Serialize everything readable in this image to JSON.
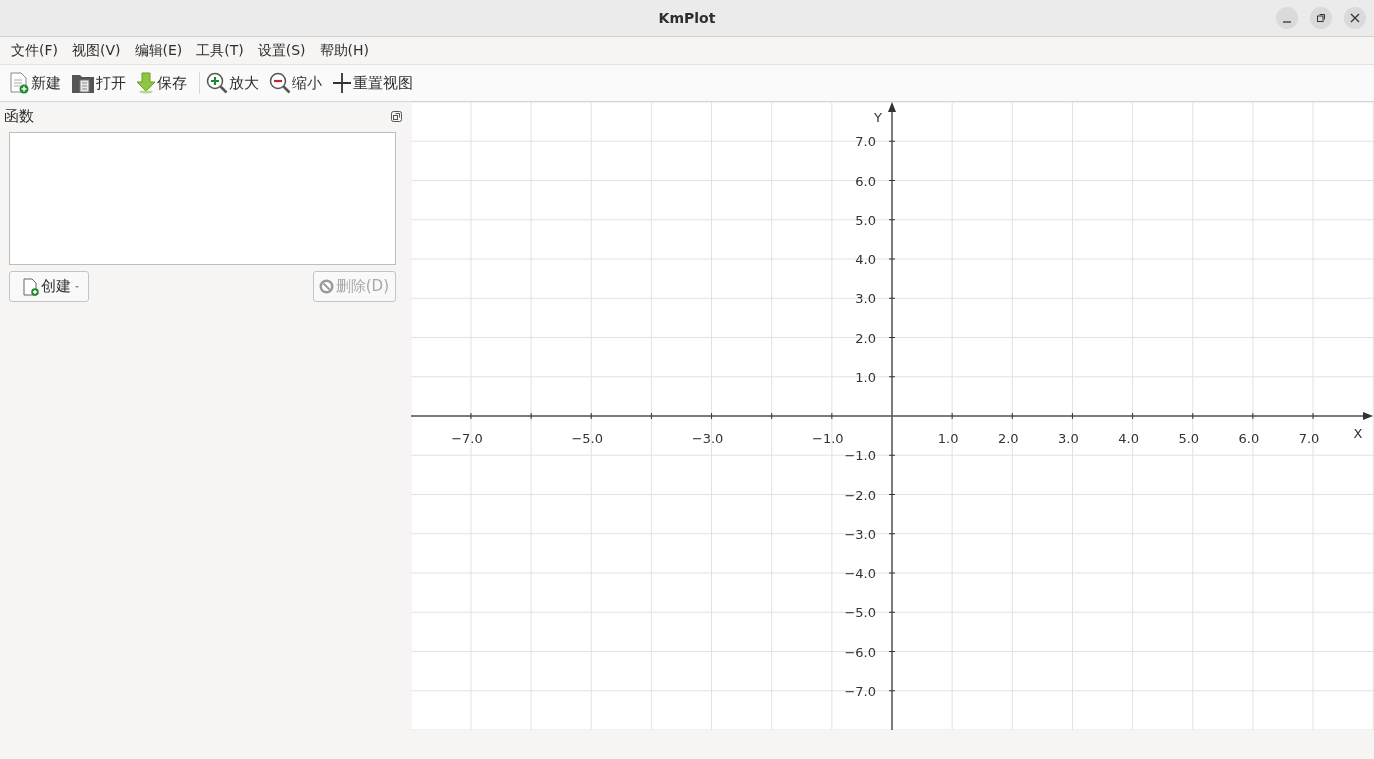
{
  "window": {
    "title": "KmPlot"
  },
  "menu": [
    "文件(F)",
    "视图(V)",
    "编辑(E)",
    "工具(T)",
    "设置(S)",
    "帮助(H)"
  ],
  "toolbar": [
    {
      "label": "新建",
      "kind": "new"
    },
    {
      "label": "打开",
      "kind": "open"
    },
    {
      "label": "保存",
      "kind": "save"
    },
    {
      "label": "放大",
      "kind": "zoomin"
    },
    {
      "label": "缩小",
      "kind": "zoomout"
    },
    {
      "label": "重置视图",
      "kind": "reset"
    }
  ],
  "functions_panel": {
    "title": "函数",
    "create_button": {
      "label": "创建"
    },
    "delete_button": {
      "label": "删除(D)",
      "disabled": true
    }
  },
  "plot": {
    "x_axis_label": "X",
    "y_axis_label": "Y",
    "x_tick_labels": [
      "−7.0",
      "−5.0",
      "−3.0",
      "−1.0",
      "1.0",
      "2.0",
      "3.0",
      "4.0",
      "5.0",
      "6.0",
      "7.0"
    ],
    "y_tick_labels": [
      "7.0",
      "6.0",
      "5.0",
      "4.0",
      "3.0",
      "2.0",
      "1.0",
      "−1.0",
      "−2.0",
      "−3.0",
      "−4.0",
      "−5.0",
      "−6.0",
      "−7.0"
    ]
  }
}
